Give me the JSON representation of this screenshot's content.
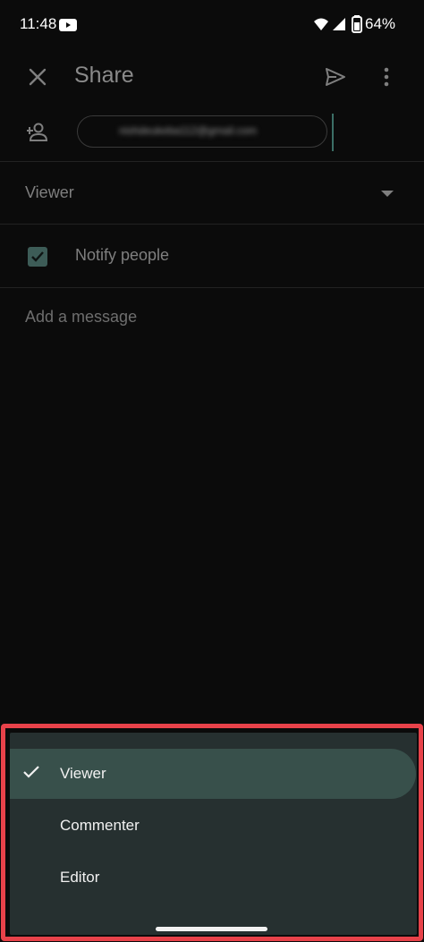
{
  "status_bar": {
    "time": "11:48",
    "battery": "64%",
    "icons": [
      "youtube-icon",
      "wifi-icon",
      "signal-icon",
      "battery-icon"
    ]
  },
  "app_bar": {
    "title": "Share",
    "icons": [
      "close-icon",
      "send-icon",
      "more-vert-icon"
    ]
  },
  "add_people": {
    "icon": "person-add-icon",
    "chip_text": "nishdeukeba112@gmail.com"
  },
  "role_field": {
    "value": "Viewer",
    "icon": "arrow-drop-down-icon"
  },
  "notify": {
    "label": "Notify people",
    "checked": true
  },
  "message": {
    "placeholder": "Add a message"
  },
  "role_menu": {
    "items": [
      {
        "label": "Viewer",
        "selected": true
      },
      {
        "label": "Commenter",
        "selected": false
      },
      {
        "label": "Editor",
        "selected": false
      }
    ]
  },
  "colors": {
    "background": "#0b0b0b",
    "sheet": "#263030",
    "selected_item": "#38504b",
    "highlight_border": "#e8424a",
    "checkbox": "#3d5c57"
  }
}
